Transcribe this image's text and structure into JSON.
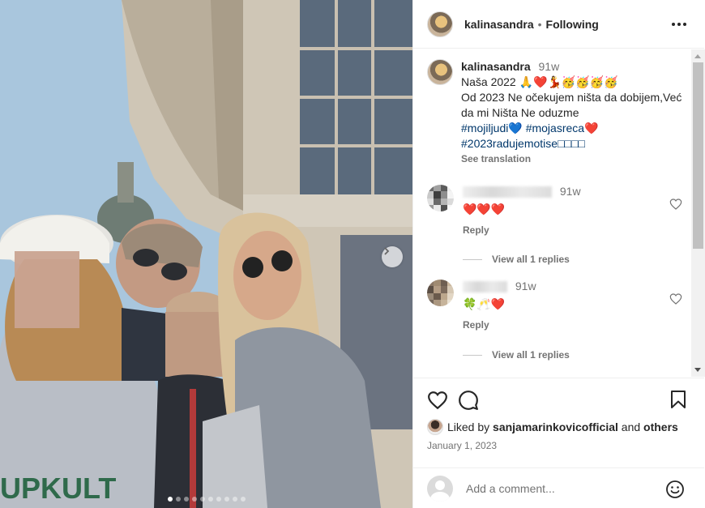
{
  "header": {
    "username": "kalinasandra",
    "separator": "•",
    "follow_status": "Following"
  },
  "caption": {
    "username": "kalinasandra",
    "time": "91w",
    "line1": "Naša 2022 🙏❤️💃🥳🥳🥳🥳",
    "line2": "Od 2023 Ne očekujem ništa da dobijem,Već da mi Ništa Ne oduzme",
    "hashtag1": "#mojiljudi",
    "hashtag1_emoji": "💙",
    "hashtag2": "#mojasreca",
    "hashtag2_emoji": "❤️",
    "hashtag3": "#2023radujemotise",
    "hashtag3_suffix": "□□□□",
    "see_translation": "See translation"
  },
  "comments": [
    {
      "time": "91w",
      "text": "❤️❤️❤️",
      "reply_label": "Reply",
      "view_replies": "View all 1 replies"
    },
    {
      "time": "91w",
      "text": "🍀🥂❤️",
      "reply_label": "Reply",
      "view_replies": "View all 1 replies"
    }
  ],
  "likes": {
    "prefix": "Liked by",
    "user": "sanjamarinkovicofficial",
    "and": "and",
    "others": "others"
  },
  "date": "January 1, 2023",
  "add_comment": {
    "placeholder": "Add a comment..."
  },
  "carousel": {
    "total_slides": 10,
    "active_index": 0
  },
  "icons": {
    "like": "heart-icon",
    "comment": "comment-icon",
    "save": "bookmark-icon",
    "more": "more-horizontal-icon",
    "next": "chevron-right-icon",
    "emoji": "emoji-icon"
  },
  "colors": {
    "hashtag": "#00376b",
    "secondary_text": "#737373"
  }
}
